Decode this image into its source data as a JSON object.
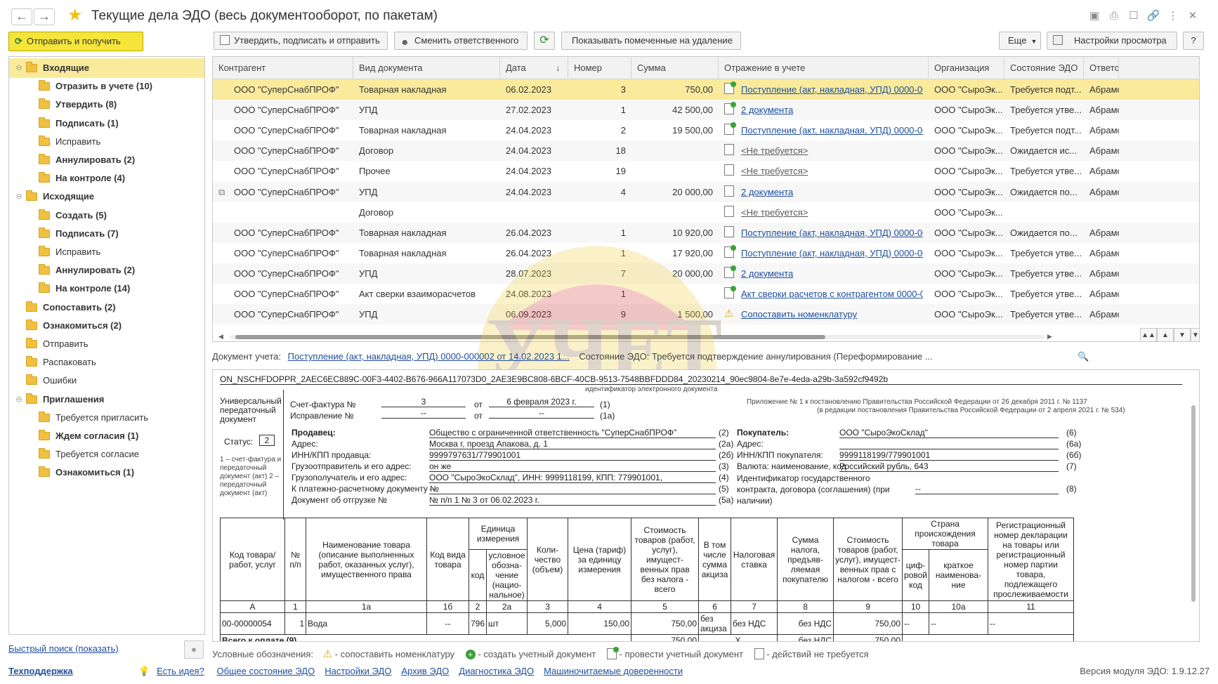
{
  "window": {
    "title": "Текущие дела ЭДО (весь документооборот, по пакетам)"
  },
  "toolbar": {
    "send_receive": "Отправить и получить",
    "approve_sign_send": "Утвердить, подписать и отправить",
    "change_responsible": "Сменить ответственного",
    "show_deleted": "Показывать помеченные на удаление",
    "more": "Еще",
    "view_settings": "Настройки просмотра",
    "help": "?"
  },
  "tree": [
    {
      "label": "Входящие",
      "level": 0,
      "bold": true,
      "expanded": true,
      "selected": true
    },
    {
      "label": "Отразить в учете (10)",
      "level": 1,
      "bold": true
    },
    {
      "label": "Утвердить (8)",
      "level": 1,
      "bold": true
    },
    {
      "label": "Подписать (1)",
      "level": 1,
      "bold": true
    },
    {
      "label": "Исправить",
      "level": 1,
      "bold": false
    },
    {
      "label": "Аннулировать (2)",
      "level": 1,
      "bold": true
    },
    {
      "label": "На контроле (4)",
      "level": 1,
      "bold": true
    },
    {
      "label": "Исходящие",
      "level": 0,
      "bold": true,
      "expanded": true
    },
    {
      "label": "Создать (5)",
      "level": 1,
      "bold": true
    },
    {
      "label": "Подписать (7)",
      "level": 1,
      "bold": true
    },
    {
      "label": "Исправить",
      "level": 1,
      "bold": false
    },
    {
      "label": "Аннулировать (2)",
      "level": 1,
      "bold": true
    },
    {
      "label": "На контроле (14)",
      "level": 1,
      "bold": true
    },
    {
      "label": "Сопоставить (2)",
      "level": 0,
      "bold": true
    },
    {
      "label": "Ознакомиться (2)",
      "level": 0,
      "bold": true
    },
    {
      "label": "Отправить",
      "level": 0,
      "bold": false
    },
    {
      "label": "Распаковать",
      "level": 0,
      "bold": false
    },
    {
      "label": "Ошибки",
      "level": 0,
      "bold": false
    },
    {
      "label": "Приглашения",
      "level": 0,
      "bold": true,
      "expanded": true
    },
    {
      "label": "Требуется пригласить",
      "level": 1,
      "bold": false
    },
    {
      "label": "Ждем согласия (1)",
      "level": 1,
      "bold": true
    },
    {
      "label": "Требуется согласие",
      "level": 1,
      "bold": false
    },
    {
      "label": "Ознакомиться (1)",
      "level": 1,
      "bold": true
    }
  ],
  "grid": {
    "columns": [
      "Контрагент",
      "Вид документа",
      "Дата",
      "Номер",
      "Сумма",
      "Отражение в учете",
      "Организация",
      "Состояние ЭДО",
      "Ответс"
    ],
    "rows": [
      {
        "contractor": "ООО \"СуперСнабПРОФ\"",
        "doctype": "Товарная накладная",
        "date": "06.02.2023",
        "number": "3",
        "sum": "750,00",
        "reflection": "Поступление (акт, накладная, УПД) 0000-000...",
        "icon": "green",
        "org": "ООО \"СыроЭк...",
        "state": "Требуется подт...",
        "resp": "Абрамо"
      },
      {
        "contractor": "ООО \"СуперСнабПРОФ\"",
        "doctype": "УПД",
        "date": "27.02.2023",
        "number": "1",
        "sum": "42 500,00",
        "reflection": "2 документа",
        "icon": "green",
        "org": "ООО \"СыроЭк...",
        "state": "Требуется утве...",
        "resp": "Абрамо"
      },
      {
        "contractor": "ООО \"СуперСнабПРОФ\"",
        "doctype": "Товарная накладная",
        "date": "24.04.2023",
        "number": "2",
        "sum": "19 500,00",
        "reflection": "Поступление (акт, накладная, УПД) 0000-000...",
        "icon": "green",
        "org": "ООО \"СыроЭк...",
        "state": "Требуется подт...",
        "resp": "Абрамо"
      },
      {
        "contractor": "ООО \"СуперСнабПРОФ\"",
        "doctype": "Договор",
        "date": "24.04.2023",
        "number": "18",
        "sum": "",
        "reflection": "<Не требуется>",
        "icon": "gray",
        "org": "ООО \"СыроЭк...",
        "state": "Ожидается ис...",
        "resp": "Абрамо"
      },
      {
        "contractor": "ООО \"СуперСнабПРОФ\"",
        "doctype": "Прочее",
        "date": "24.04.2023",
        "number": "19",
        "sum": "",
        "reflection": "<Не требуется>",
        "icon": "gray",
        "org": "ООО \"СыроЭк...",
        "state": "Требуется утве...",
        "resp": "Абрамо"
      },
      {
        "contractor": "ООО \"СуперСнабПРОФ\"",
        "doctype": "УПД",
        "date": "24.04.2023",
        "number": "4",
        "sum": "20 000,00",
        "reflection": "2 документа",
        "icon": "gray",
        "org": "ООО \"СыроЭк...",
        "state": "Ожидается по...",
        "resp": "Абрамо",
        "package": true
      },
      {
        "contractor": "",
        "doctype": "Договор",
        "date": "",
        "number": "",
        "sum": "",
        "reflection": "<Не требуется>",
        "icon": "gray",
        "org": "ООО \"СыроЭк...",
        "state": "",
        "resp": ""
      },
      {
        "contractor": "ООО \"СуперСнабПРОФ\"",
        "doctype": "Товарная накладная",
        "date": "26.04.2023",
        "number": "1",
        "sum": "10 920,00",
        "reflection": "Поступление (акт, накладная, УПД) 0000-000...",
        "icon": "gray",
        "org": "ООО \"СыроЭк...",
        "state": "Ожидается по...",
        "resp": "Абрамо"
      },
      {
        "contractor": "ООО \"СуперСнабПРОФ\"",
        "doctype": "Товарная накладная",
        "date": "26.04.2023",
        "number": "1",
        "sum": "17 920,00",
        "reflection": "Поступление (акт, накладная, УПД) 0000-000...",
        "icon": "green",
        "org": "ООО \"СыроЭк...",
        "state": "Требуется утве...",
        "resp": "Абрамо"
      },
      {
        "contractor": "ООО \"СуперСнабПРОФ\"",
        "doctype": "УПД",
        "date": "28.07.2023",
        "number": "7",
        "sum": "20 000,00",
        "reflection": "2 документа",
        "icon": "green",
        "org": "ООО \"СыроЭк...",
        "state": "Требуется утве...",
        "resp": "Абрамо"
      },
      {
        "contractor": "ООО \"СуперСнабПРОФ\"",
        "doctype": "Акт сверки взаиморасчетов",
        "date": "24.08.2023",
        "number": "1",
        "sum": "",
        "reflection": "Акт сверки расчетов с контрагентом 0000-000...",
        "icon": "green",
        "org": "ООО \"СыроЭк...",
        "state": "Требуется утве...",
        "resp": "Абрамо"
      },
      {
        "contractor": "ООО \"СуперСнабПРОФ\"",
        "doctype": "УПД",
        "date": "06.09.2023",
        "number": "9",
        "sum": "1 500,00",
        "reflection": "Сопоставить номенклатуру",
        "icon": "warn",
        "org": "ООО \"СыроЭк...",
        "state": "Требуется утве...",
        "resp": "Абрамо"
      }
    ]
  },
  "docline": {
    "label": "Документ учета:",
    "link": "Поступление (акт, накладная, УПД) 0000-000002 от 14.02.2023 1...",
    "state": "Состояние ЭДО: Требуется подтверждение аннулирования (Переформирование ..."
  },
  "form": {
    "doc_id": "ON_NSCHFDOPPR_2AEC6EC889C-00F3-4402-B676-966A117073D0_2AE3E9BC808-6BCF-40CB-9513-7548BBFDDD84_20230214_90ec9804-8e7e-4eda-a29b-3a592cf9492b",
    "doc_id_caption": "идентификатор электронного документа",
    "upd_title": "Универсальный передаточный документ",
    "status_label": "Статус:",
    "status_value": "2",
    "status_note": "1 – счет-фактура и передаточный документ (акт) 2 – передаточный документ (акт)",
    "invoice_label": "Счет-фактура №",
    "invoice_no": "3",
    "ot": "от",
    "invoice_date": "6 февраля 2023 г.",
    "code1": "(1)",
    "correction_label": "Исправление №",
    "correction_no": "--",
    "correction_date": "--",
    "code1a": "(1а)",
    "appendix": "Приложение № 1 к постановлению Правительства Российской Федерации от 26 декабря 2011 г. № 1137",
    "appendix2": "(в редакции постановления Правительства Российской Федерации от 2 апреля 2021 г. № 534)",
    "seller_label": "Продавец:",
    "seller": "Общество с ограниченной ответственность \"СуперСнабПРОФ\"",
    "seller_code": "(2)",
    "address_label": "Адрес:",
    "seller_address": "Москва г, проезд Апакова, д. 1",
    "seller_address_code": "(2а)",
    "inn_seller_label": "ИНН/КПП продавца:",
    "inn_seller": "9999797631/779901001",
    "inn_seller_code": "(2б)",
    "shipper_label": "Грузоотправитель и его адрес:",
    "shipper": "он же",
    "shipper_code": "(3)",
    "consignee_label": "Грузополучатель и его адрес:",
    "consignee": "ООО \"СыроЭкоСклад\", ИНН: 9999118199, КПП: 779901001,",
    "consignee_code": "(4)",
    "payment_label": "К платежно-расчетному документу №",
    "payment": "--",
    "payment_code": "(5)",
    "shipment_label": "Документ об отгрузке №",
    "shipment": "№ п/п 1 № 3 от 06.02.2023 г.",
    "shipment_code": "(5а)",
    "buyer_label": "Покупатель:",
    "buyer": "ООО \"СыроЭкоСклад\"",
    "buyer_code": "(6)",
    "buyer_address_label": "Адрес:",
    "buyer_address_code": "(6а)",
    "inn_buyer_label": "ИНН/КПП покупателя:",
    "inn_buyer": "9999118199/779901001",
    "inn_buyer_code": "(6б)",
    "currency_label": "Валюта: наименование, код",
    "currency": "Российский рубль, 643",
    "currency_code": "(7)",
    "contract_label": "Идентификатор государственного контракта, договора (соглашения) (при наличии)",
    "contract": "--",
    "contract_code": "(8)",
    "table_headers": {
      "code": "Код товара/ работ, услуг",
      "npp": "№ п/п",
      "name": "Наименование товара (описание выполненных работ, оказанных услуг), имущественного права",
      "kind": "Код вида товара",
      "unit": "Единица измерения",
      "unit_code": "код",
      "unit_name": "условное обозна-чение (нацио-нальное)",
      "qty": "Коли-чество (объем)",
      "price": "Цена (тариф) за единицу измерения",
      "cost": "Стоимость товаров (работ, услуг), имущест-венных прав без налога - всего",
      "excise": "В том числе сумма акциза",
      "rate": "Налоговая ставка",
      "tax": "Сумма налога, предъяв-ляемая покупателю",
      "total": "Стоимость товаров (работ, услуг), имущест-венных прав с налогом - всего",
      "country": "Страна происхождения товара",
      "country_code": "циф-ровой код",
      "country_name": "краткое наименова-ние",
      "decl": "Регистрационный номер декларации на товары или регистрационный номер партии товара, подлежащего прослеживаемости"
    },
    "col_nums": [
      "А",
      "1",
      "1а",
      "1б",
      "2",
      "2а",
      "3",
      "4",
      "5",
      "6",
      "7",
      "8",
      "9",
      "10",
      "10а",
      "11"
    ],
    "item": {
      "code": "00-00000054",
      "npp": "1",
      "name": "Вода",
      "kind": "--",
      "unit_code": "796",
      "unit_name": "шт",
      "qty": "5,000",
      "price": "150,00",
      "cost": "750,00",
      "excise": "без акциза",
      "rate": "без НДС",
      "tax": "без НДС",
      "total": "750,00",
      "country_code": "--",
      "country_name": "--",
      "decl": "--"
    },
    "total_row": {
      "label": "Всего к оплате (9)",
      "cost": "750,00",
      "excise": "X",
      "tax": "без НДС",
      "total": "750,00"
    }
  },
  "legend": {
    "label": "Условные обозначения:",
    "match": "- сопоставить номенклатуру",
    "create": "- создать учетный документ",
    "post": "- провести учетный документ",
    "none": "- действий не требуется"
  },
  "footer": {
    "quick_search": "Быстрый поиск (показать)",
    "support": "Техподдержка",
    "idea": "Есть идея?",
    "links": [
      "Общее состояние ЭДО",
      "Настройки ЭДО",
      "Архив ЭДО",
      "Диагностика ЭДО",
      "Машиночитаемые доверенности"
    ],
    "version": "Версия модуля ЭДО: 1.9.12.27"
  },
  "colors": {
    "accent": "#f5e53a",
    "selection": "#faeb9c",
    "link": "#1f4e9d"
  }
}
